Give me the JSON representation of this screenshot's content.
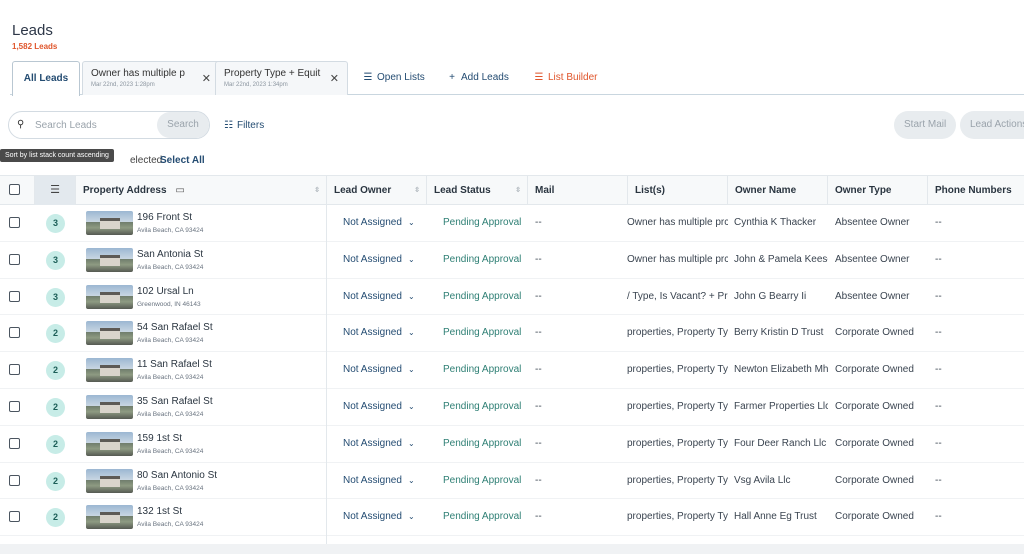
{
  "header": {
    "title": "Leads",
    "count": "1,582 Leads"
  },
  "tabs": {
    "active": "All Leads",
    "saved": [
      {
        "name": "Owner has multiple p",
        "date": "Mar 22nd, 2023 1:28pm"
      },
      {
        "name": "Property Type + Equit",
        "date": "Mar 22nd, 2023 1:34pm"
      }
    ],
    "actions": {
      "open_lists": "Open Lists",
      "add_leads": "Add Leads",
      "list_builder": "List Builder"
    }
  },
  "toolbar": {
    "search_placeholder": "Search Leads",
    "search_button": "Search",
    "filters": "Filters",
    "start_mail": "Start Mail",
    "lead_actions": "Lead Actions",
    "tooltip": "Sort by list stack count ascending",
    "selected_text": "elected.",
    "select_all": "Select All"
  },
  "columns": [
    "Property Address",
    "Lead Owner",
    "Lead Status",
    "Mail",
    "List(s)",
    "Owner Name",
    "Owner Type",
    "Phone Numbers"
  ],
  "rows": [
    {
      "count": "3",
      "street": "196 Front St",
      "city": "Avila Beach, CA 93424",
      "owner": "Not Assigned",
      "status": "Pending Approval",
      "mail": "--",
      "lists": "Owner has multiple prc",
      "owner_name": "Cynthia K Thacker",
      "owner_type": "Absentee Owner",
      "phones": "--"
    },
    {
      "count": "3",
      "street": "San Antonia St",
      "city": "Avila Beach, CA 93424",
      "owner": "Not Assigned",
      "status": "Pending Approval",
      "mail": "--",
      "lists": "Owner has multiple prc",
      "owner_name": "John & Pamela Keese",
      "owner_type": "Absentee Owner",
      "phones": "--"
    },
    {
      "count": "3",
      "street": "102 Ursal Ln",
      "city": "Greenwood, IN 46143",
      "owner": "Not Assigned",
      "status": "Pending Approval",
      "mail": "--",
      "lists": "/ Type, Is Vacant? + Proj",
      "owner_name": "John G Bearry Ii",
      "owner_type": "Absentee Owner",
      "phones": "--"
    },
    {
      "count": "2",
      "street": "54 San Rafael St",
      "city": "Avila Beach, CA 93424",
      "owner": "Not Assigned",
      "status": "Pending Approval",
      "mail": "--",
      "lists": "properties, Property Ty",
      "owner_name": "Berry Kristin D Trust",
      "owner_type": "Corporate Owned",
      "phones": "--"
    },
    {
      "count": "2",
      "street": "11 San Rafael St",
      "city": "Avila Beach, CA 93424",
      "owner": "Not Assigned",
      "status": "Pending Approval",
      "mail": "--",
      "lists": "properties, Property Ty",
      "owner_name": "Newton Elizabeth Mh",
      "owner_type": "Corporate Owned",
      "phones": "--"
    },
    {
      "count": "2",
      "street": "35 San Rafael St",
      "city": "Avila Beach, CA 93424",
      "owner": "Not Assigned",
      "status": "Pending Approval",
      "mail": "--",
      "lists": "properties, Property Ty",
      "owner_name": "Farmer Properties Llc",
      "owner_type": "Corporate Owned",
      "phones": "--"
    },
    {
      "count": "2",
      "street": "159 1st St",
      "city": "Avila Beach, CA 93424",
      "owner": "Not Assigned",
      "status": "Pending Approval",
      "mail": "--",
      "lists": "properties, Property Ty",
      "owner_name": "Four Deer Ranch Llc",
      "owner_type": "Corporate Owned",
      "phones": "--"
    },
    {
      "count": "2",
      "street": "80 San Antonio St",
      "city": "Avila Beach, CA 93424",
      "owner": "Not Assigned",
      "status": "Pending Approval",
      "mail": "--",
      "lists": "properties, Property Ty",
      "owner_name": "Vsg Avila Llc",
      "owner_type": "Corporate Owned",
      "phones": "--"
    },
    {
      "count": "2",
      "street": "132 1st St",
      "city": "Avila Beach, CA 93424",
      "owner": "Not Assigned",
      "status": "Pending Approval",
      "mail": "--",
      "lists": "properties, Property Ty",
      "owner_name": "Hall Anne Eg Trust",
      "owner_type": "Corporate Owned",
      "phones": "--"
    }
  ],
  "colors": {
    "accent": "#244c72",
    "orange": "#e0552b",
    "status": "#2e7f74",
    "badge": "#c7ece7"
  }
}
